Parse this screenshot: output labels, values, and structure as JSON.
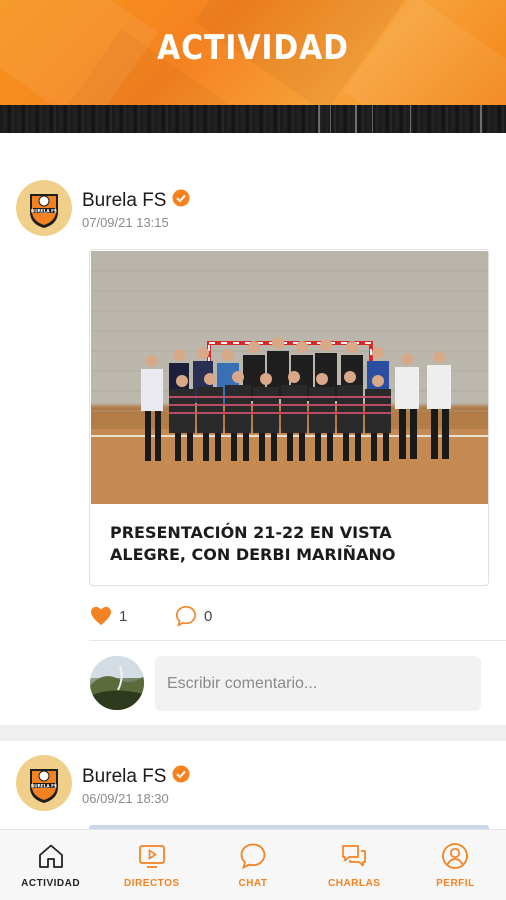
{
  "header": {
    "title": "ACTIVIDAD"
  },
  "posts": [
    {
      "author": "Burela FS",
      "timestamp": "07/09/21 13:15",
      "title": "PRESENTACIÓN 21-22 EN VISTA ALEGRE, CON DERBI MARIÑANO",
      "likes": "1",
      "comments": "0"
    },
    {
      "author": "Burela FS",
      "timestamp": "06/09/21 18:30"
    }
  ],
  "comment_box": {
    "placeholder": "Escribir comentario..."
  },
  "nav": [
    {
      "label": "ACTIVIDAD",
      "icon": "home-icon",
      "active": true
    },
    {
      "label": "DIRECTOS",
      "icon": "play-icon"
    },
    {
      "label": "CHAT",
      "icon": "chat-bubble-icon"
    },
    {
      "label": "CHARLAS",
      "icon": "chats-icon"
    },
    {
      "label": "PERFIL",
      "icon": "user-icon"
    }
  ],
  "colors": {
    "accent": "#f58220",
    "verified": "#f58220",
    "dark": "#222222"
  }
}
